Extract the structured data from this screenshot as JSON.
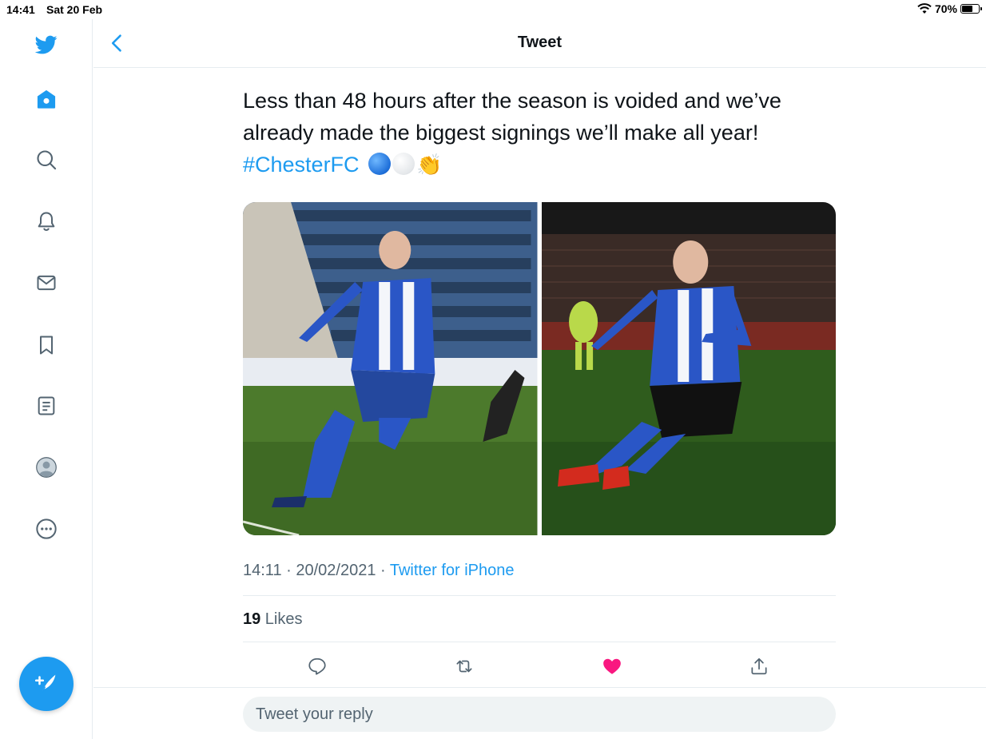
{
  "status_bar": {
    "time": "14:41",
    "date": "Sat 20 Feb",
    "battery": "70%",
    "battery_level": 0.7
  },
  "sidebar": {
    "items": [
      {
        "name": "twitter-logo-icon"
      },
      {
        "name": "home-icon"
      },
      {
        "name": "explore-icon"
      },
      {
        "name": "notifications-icon"
      },
      {
        "name": "messages-icon"
      },
      {
        "name": "bookmarks-icon"
      },
      {
        "name": "lists-icon"
      },
      {
        "name": "profile-icon"
      },
      {
        "name": "more-icon"
      }
    ],
    "compose_icon": "feather-plus-icon"
  },
  "header": {
    "title": "Tweet",
    "back_icon": "chevron-left-icon"
  },
  "tweet": {
    "text_line1": "Less than 48 hours after the season is voided and we’ve",
    "text_line2": "already made the biggest signings we’ll make all year!",
    "hashtag": "#ChesterFC",
    "emoji_clap": "👏",
    "timestamp": "14:11 · 20/02/2021 · ",
    "source": "Twitter for iPhone",
    "likes_count": "19",
    "likes_label": " Likes",
    "liked": true
  },
  "reply": {
    "placeholder": "Tweet your reply"
  },
  "colors": {
    "accent": "#1d9bf0",
    "like": "#f91880",
    "divider": "#e6ecf0"
  }
}
